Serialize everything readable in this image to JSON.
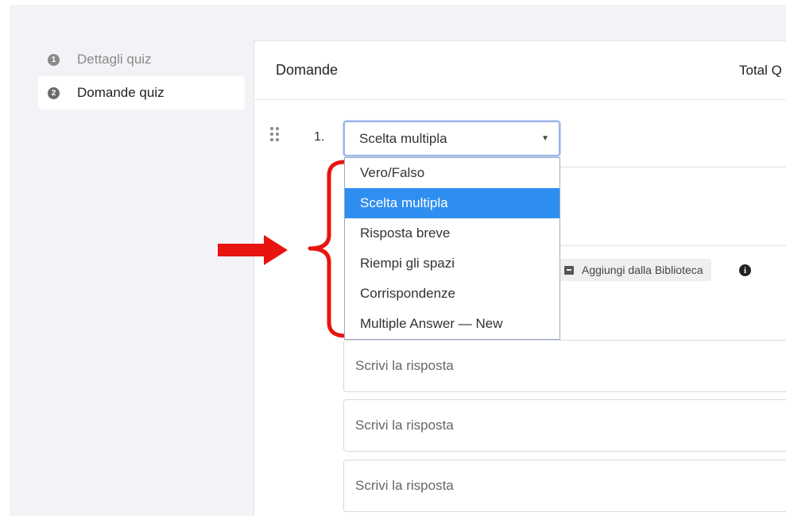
{
  "sidebar": {
    "steps": [
      {
        "number": "1",
        "label": "Dettagli quiz"
      },
      {
        "number": "2",
        "label": "Domande quiz"
      }
    ]
  },
  "panel": {
    "title": "Domande",
    "total_label": "Total Q"
  },
  "question": {
    "number": "1.",
    "type_select": {
      "value": "Scelta multipla",
      "options": [
        "Vero/Falso",
        "Scelta multipla",
        "Risposta breve",
        "Riempi gli spazi",
        "Corrispondenze",
        "Multiple Answer — New"
      ],
      "selected_index": 1
    },
    "library_button": "Aggiungi dalla Biblioteca",
    "info_glyph": "i",
    "answers": [
      {
        "placeholder": "Scrivi la risposta"
      },
      {
        "placeholder": "Scrivi la risposta"
      },
      {
        "placeholder": "Scrivi la risposta"
      }
    ]
  },
  "annotation": {
    "color": "#e8140f",
    "shapes": [
      "right-arrow",
      "left-curly-brace"
    ]
  },
  "colors": {
    "highlight": "#2f8ff0",
    "background": "#f3f3f7"
  }
}
